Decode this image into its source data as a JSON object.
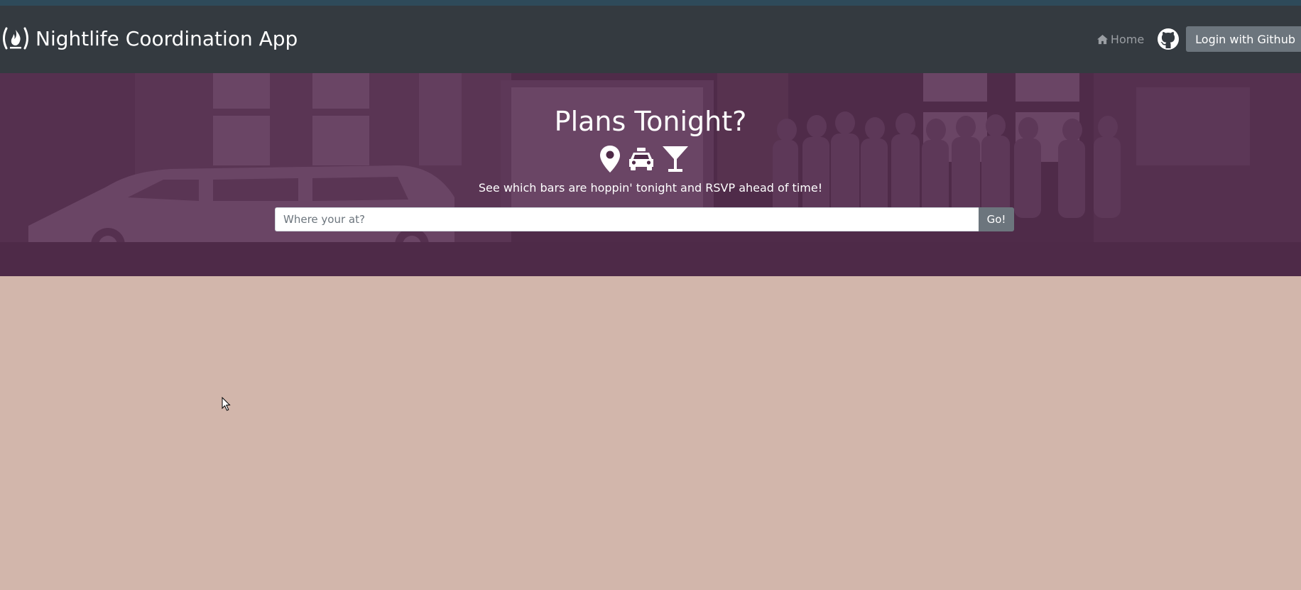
{
  "header": {
    "brand_title": "Nightlife Coordination App",
    "brand_icon": "freecodecamp-flame-icon",
    "home_label": "Home",
    "home_icon": "home-icon",
    "github_icon": "github-icon",
    "login_label": "Login with Github"
  },
  "hero": {
    "title": "Plans Tonight?",
    "icons": [
      "map-marker-icon",
      "taxi-icon",
      "cocktail-icon"
    ],
    "subtitle": "See which bars are hoppin' tonight and RSVP ahead of time!",
    "search": {
      "placeholder": "Where your at?",
      "value": "",
      "button_label": "Go!"
    }
  },
  "colors": {
    "navbar": "#343a40",
    "hero": "#4e2a48",
    "page_background": "#d2b6ab",
    "button": "#6c757d"
  }
}
